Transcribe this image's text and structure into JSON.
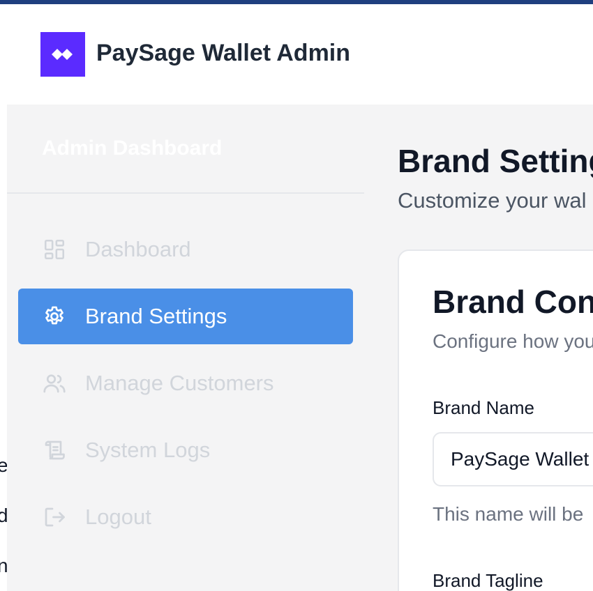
{
  "window": {
    "left_edge_fragments": [
      "e",
      "d",
      "n"
    ]
  },
  "header": {
    "title": "PaySage Wallet Admin",
    "logo_icon": "double-diamond-icon",
    "logo_color": "#5b2bff"
  },
  "sidebar": {
    "title": "Admin Dashboard",
    "items": [
      {
        "label": "Dashboard",
        "icon": "dashboard-grid-icon",
        "active": false
      },
      {
        "label": "Brand Settings",
        "icon": "gear-icon",
        "active": true
      },
      {
        "label": "Manage Customers",
        "icon": "users-icon",
        "active": false
      },
      {
        "label": "System Logs",
        "icon": "scroll-icon",
        "active": false
      },
      {
        "label": "Logout",
        "icon": "logout-icon",
        "active": false
      }
    ],
    "active_color": "#4a8fe7"
  },
  "main": {
    "page_title": "Brand Settings",
    "page_subtitle": "Customize your wal",
    "card": {
      "title": "Brand Conf",
      "description": "Configure how you",
      "fields": {
        "brand_name": {
          "label": "Brand Name",
          "value": "PaySage Wallet",
          "help": "This name will be"
        },
        "brand_tagline": {
          "label": "Brand Tagline"
        }
      }
    }
  }
}
